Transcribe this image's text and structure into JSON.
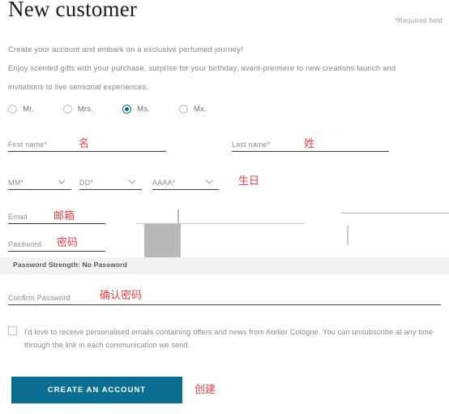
{
  "header": {
    "title": "New customer",
    "required_note": "*Required field"
  },
  "intro": {
    "line1": "Create your account and embark on a exclusive perfumed journey!",
    "line2": "Enjoy scented gifts with your purchase, surprise for your birthday, avant-premiere to new creations launch and",
    "line3": "invitations to live sensorial experiences."
  },
  "salutation": {
    "options": [
      {
        "label": "Mr.",
        "selected": false
      },
      {
        "label": "Mrs.",
        "selected": false
      },
      {
        "label": "Ms.",
        "selected": true
      },
      {
        "label": "Mx.",
        "selected": false
      }
    ]
  },
  "fields": {
    "first_name": {
      "label": "First name*",
      "value": "",
      "annotation": "名"
    },
    "last_name": {
      "label": "Last name*",
      "value": "",
      "annotation": "姓"
    },
    "birth_month": {
      "label": "MM*",
      "value": "MM*"
    },
    "birth_day": {
      "label": "DD*",
      "value": "DD*"
    },
    "birth_year": {
      "label": "AAAA*",
      "value": "AAAA*"
    },
    "birth_annotation": "生日",
    "email": {
      "label": "Email",
      "value": "",
      "annotation": "邮箱"
    },
    "password": {
      "label": "Password",
      "value": "",
      "annotation": "密码"
    },
    "confirm_password": {
      "label": "Confirm Password",
      "value": "",
      "annotation": "确认密码"
    }
  },
  "password_strength": {
    "text": "Password Strength: No Password"
  },
  "consent": {
    "checked": false,
    "text": "I'd love to receive personalised emails containing offers and news from Atelier Cologne. You can unsubscribe at any time through the link in each communication we send."
  },
  "submit": {
    "label": "CREATE AN ACCOUNT",
    "annotation": "创建"
  },
  "colors": {
    "accent": "#0d6e94",
    "annotation": "#e8414a",
    "label": "#8d8d8d",
    "strength_bar": "#f2f2f2"
  }
}
